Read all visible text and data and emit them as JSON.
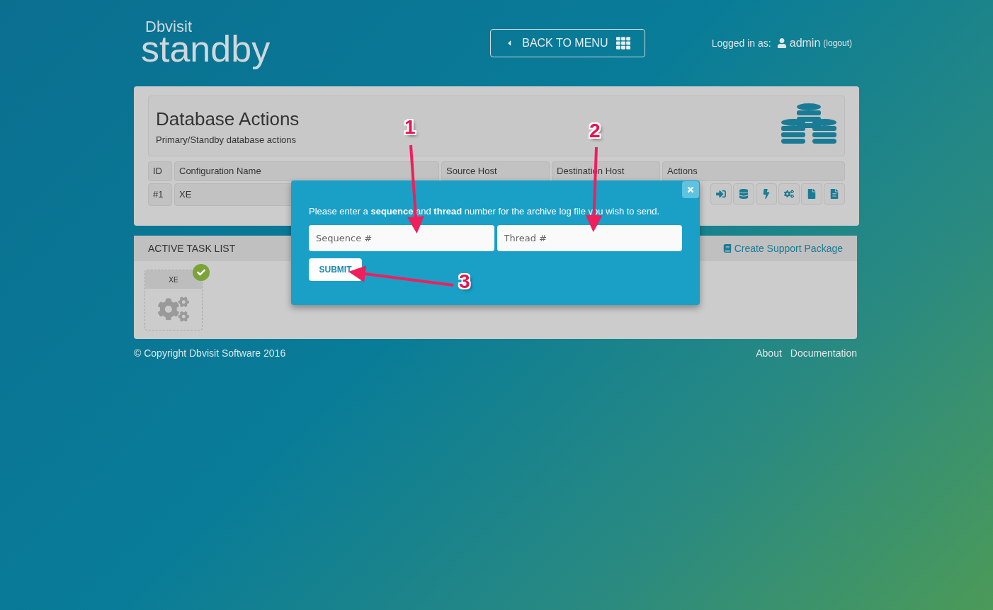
{
  "header": {
    "logo_small": "Dbvisit",
    "logo_large": "standby",
    "back_button": "BACK TO MENU",
    "logged_in_label": "Logged in as:",
    "user": "admin",
    "logout": "(logout)"
  },
  "panel": {
    "title": "Database Actions",
    "subtitle": "Primary/Standby database actions",
    "columns": [
      "ID",
      "Configuration Name",
      "Source Host",
      "Destination Host",
      "Actions"
    ],
    "rows": [
      {
        "cells": [
          "#1",
          "XE"
        ]
      }
    ]
  },
  "task_list": {
    "title": "ACTIVE TASK LIST",
    "links": [
      {
        "kind": "support",
        "label": "Create Support Package"
      }
    ],
    "tasks": [
      {
        "name": "XE",
        "done": true
      }
    ]
  },
  "footer": {
    "copyright": "© Copyright Dbvisit Software 2016",
    "links": [
      "About",
      "Documentation"
    ]
  },
  "modal": {
    "message": "Please enter a **sequence** and **thread** number for the archive log file you wish to send.",
    "fields": [
      {
        "placeholder": "Sequence #"
      },
      {
        "placeholder": "Thread #"
      }
    ],
    "submit": "SUBMIT"
  },
  "annotations": [
    {
      "label": "1"
    },
    {
      "label": "2"
    },
    {
      "label": "3"
    }
  ]
}
